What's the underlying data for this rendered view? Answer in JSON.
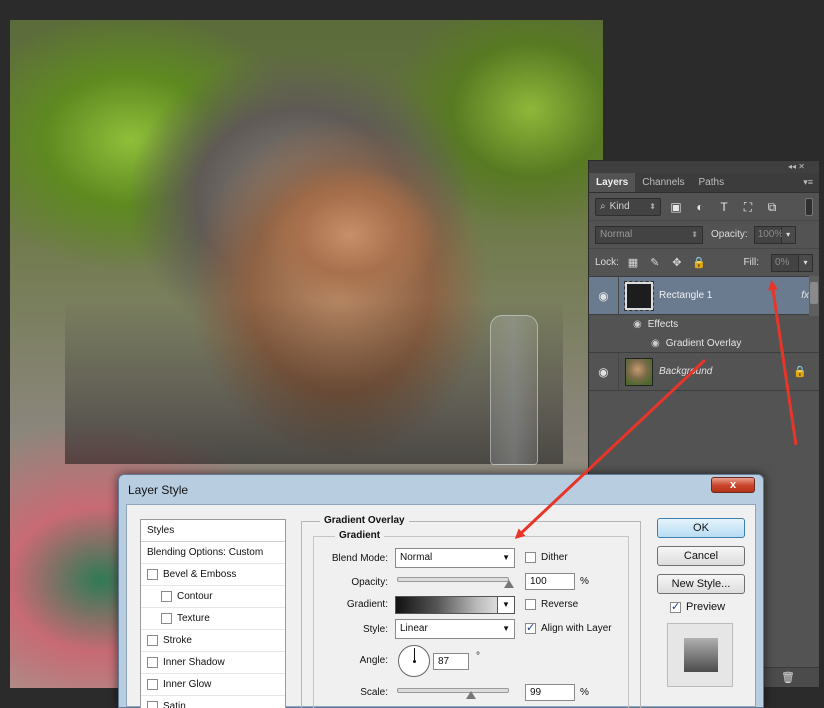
{
  "layers_panel": {
    "tabs": [
      "Layers",
      "Channels",
      "Paths"
    ],
    "filter_kind": "Kind",
    "blend_mode": "Normal",
    "opacity_label": "Opacity:",
    "opacity_value": "100%",
    "lock_label": "Lock:",
    "fill_label": "Fill:",
    "fill_value": "0%",
    "layers": [
      {
        "name": "Rectangle 1",
        "badge": "fx"
      },
      {
        "name": "Background"
      }
    ],
    "effects_label": "Effects",
    "effect_item": "Gradient Overlay"
  },
  "dialog": {
    "title": "Layer Style",
    "close": "x",
    "styles_header": "Styles",
    "style_items": [
      {
        "label": "Blending Options: Custom",
        "checkbox": false,
        "indent": false
      },
      {
        "label": "Bevel & Emboss",
        "checkbox": true,
        "indent": false
      },
      {
        "label": "Contour",
        "checkbox": true,
        "indent": true
      },
      {
        "label": "Texture",
        "checkbox": true,
        "indent": true
      },
      {
        "label": "Stroke",
        "checkbox": true,
        "indent": false
      },
      {
        "label": "Inner Shadow",
        "checkbox": true,
        "indent": false
      },
      {
        "label": "Inner Glow",
        "checkbox": true,
        "indent": false
      },
      {
        "label": "Satin",
        "checkbox": true,
        "indent": false
      }
    ],
    "section_title": "Gradient Overlay",
    "group_title": "Gradient",
    "blend_mode_label": "Blend Mode:",
    "blend_mode_value": "Normal",
    "dither_label": "Dither",
    "opacity_label": "Opacity:",
    "opacity_value": "100",
    "opacity_unit": "%",
    "opacity_level": 1.0,
    "gradient_label": "Gradient:",
    "reverse_label": "Reverse",
    "style_label": "Style:",
    "style_value": "Linear",
    "align_label": "Align with Layer",
    "angle_label": "Angle:",
    "angle_value": "87",
    "angle_unit": "°",
    "scale_label": "Scale:",
    "scale_value": "99",
    "scale_unit": "%",
    "scale_level": 0.66,
    "buttons": {
      "ok": "OK",
      "cancel": "Cancel",
      "new_style": "New Style..."
    },
    "preview_label": "Preview"
  },
  "colors": {
    "panel_bg": "#535353",
    "selected_layer": "#6a7a8f",
    "dialog_chrome": "#b9cde1",
    "arrow": "#e8352a"
  }
}
